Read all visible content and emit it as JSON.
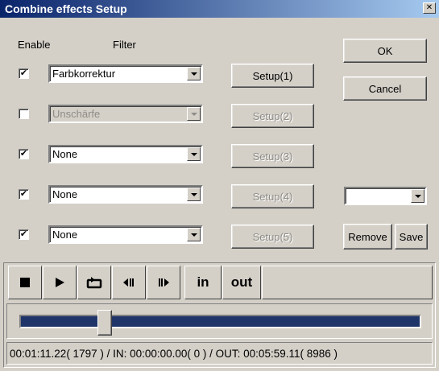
{
  "window": {
    "title": "Combine effects Setup",
    "close_glyph": "✕"
  },
  "headers": {
    "enable": "Enable",
    "filter": "Filter"
  },
  "rows": [
    {
      "checked": "✔",
      "filter": "Farbkorrektur",
      "setup": "Setup(1)"
    },
    {
      "checked": "",
      "filter": "Unschärfe",
      "setup": "Setup(2)"
    },
    {
      "checked": "✔",
      "filter": "None",
      "setup": "Setup(3)"
    },
    {
      "checked": "✔",
      "filter": "None",
      "setup": "Setup(4)"
    },
    {
      "checked": "✔",
      "filter": "None",
      "setup": "Setup(5)"
    }
  ],
  "buttons": {
    "ok": "OK",
    "cancel": "Cancel",
    "remove": "Remove",
    "save": "Save"
  },
  "preset_select": {
    "value": ""
  },
  "transport": {
    "in": "in",
    "out": "out"
  },
  "slider": {
    "position_fraction": 0.2
  },
  "status": {
    "text": "00:01:11.22( 1797 ) / IN: 00:00:00.00( 0 ) / OUT: 00:05:59.11( 8986 )"
  }
}
